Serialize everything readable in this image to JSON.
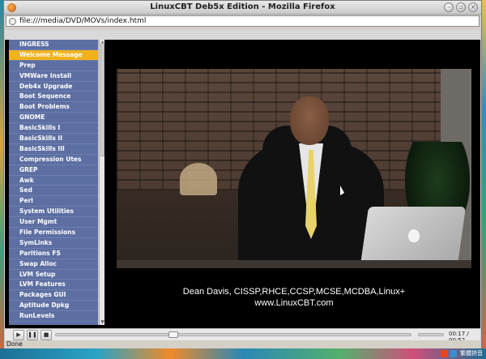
{
  "window": {
    "title": "LinuxCBT Deb5x Edition - Mozilla Firefox",
    "url": "file:///media/DVD/MOVs/index.html",
    "status": "Done"
  },
  "sidebar": {
    "items": [
      {
        "label": "INGRESS"
      },
      {
        "label": "Welcome Message",
        "active": true
      },
      {
        "label": "Prep"
      },
      {
        "label": "VMWare Install"
      },
      {
        "label": "Deb4x Upgrade"
      },
      {
        "label": "Boot Sequence"
      },
      {
        "label": "Boot Problems"
      },
      {
        "label": "GNOME"
      },
      {
        "label": "BasicSkills I"
      },
      {
        "label": "BasicSkills II"
      },
      {
        "label": "BasicSkills III"
      },
      {
        "label": "Compression Utes"
      },
      {
        "label": "GREP"
      },
      {
        "label": "Awk"
      },
      {
        "label": "Sed"
      },
      {
        "label": "Perl"
      },
      {
        "label": "System Utilities"
      },
      {
        "label": "User Mgmt"
      },
      {
        "label": "File Permissions"
      },
      {
        "label": "SymLinks"
      },
      {
        "label": "Paritions FS"
      },
      {
        "label": "Swap Alloc"
      },
      {
        "label": "LVM Setup"
      },
      {
        "label": "LVM Features"
      },
      {
        "label": "Packages GUI"
      },
      {
        "label": "Aptitude Dpkg"
      },
      {
        "label": "RunLevels"
      }
    ]
  },
  "video": {
    "caption_line1": "Dean Davis, CISSP,RHCE,CCSP,MCSE,MCDBA,Linux+",
    "caption_line2": "www.LinuxCBT.com"
  },
  "player": {
    "play_icon": "play-icon",
    "pause_icon": "pause-icon",
    "stop_icon": "stop-icon",
    "time": "00:17 / 00:52",
    "progress": 0.33
  },
  "tray": {
    "text": "繁體拼音"
  }
}
